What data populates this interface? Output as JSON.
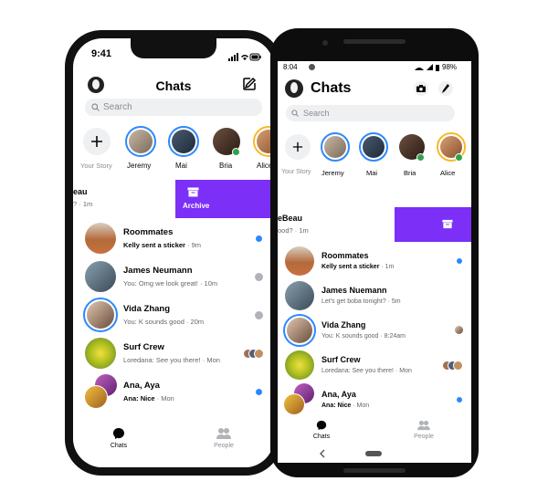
{
  "iphone": {
    "time": "9:41",
    "title": "Chats",
    "search_placeholder": "Search",
    "stories": [
      {
        "name": "Your Story"
      },
      {
        "name": "Jeremy"
      },
      {
        "name": "Mai"
      },
      {
        "name": "Bria"
      },
      {
        "name": "Alice"
      }
    ],
    "swiped_row": {
      "name_fragment": "eau",
      "sub_fragment": "? · 1m",
      "action_label": "Archive"
    },
    "chats": [
      {
        "name": "Roommates",
        "sender": "Kelly sent a sticker",
        "time": "9m",
        "status": "unread"
      },
      {
        "name": "James Neumann",
        "preview": "You: Omg we look great!",
        "time": "10m",
        "status": "sent"
      },
      {
        "name": "Vida Zhang",
        "preview": "You: K sounds good",
        "time": "20m",
        "status": "sent"
      },
      {
        "name": "Surf Crew",
        "preview": "Loredana: See you there!",
        "time": "Mon",
        "status": "seen"
      },
      {
        "name": "Ana, Aya",
        "sender": "Ana: Nice",
        "time": "Mon",
        "status": "unread"
      }
    ],
    "tabs": [
      {
        "label": "Chats"
      },
      {
        "label": "People"
      }
    ]
  },
  "android": {
    "time": "8:04",
    "battery": "98%",
    "title": "Chats",
    "search_placeholder": "Search",
    "stories": [
      {
        "name": "Your Story"
      },
      {
        "name": "Jeremy"
      },
      {
        "name": "Mai"
      },
      {
        "name": "Bria"
      },
      {
        "name": "Alice"
      }
    ],
    "swiped_row": {
      "name_fragment": "eBeau",
      "sub_fragment": "ood? · 1m"
    },
    "chats": [
      {
        "name": "Roommates",
        "sender": "Kelly sent a sticker",
        "time": "1m",
        "status": "unread"
      },
      {
        "name": "James Nuemann",
        "preview": "Let's get boba tonight?",
        "time": "5m",
        "status": "none"
      },
      {
        "name": "Vida Zhang",
        "preview": "You: K sounds good",
        "time": "8:24am",
        "status": "seen"
      },
      {
        "name": "Surf Crew",
        "preview": "Loredana: See you there!",
        "time": "Mon",
        "status": "seen"
      },
      {
        "name": "Ana, Aya",
        "sender": "Ana: Nice",
        "time": "Mon",
        "status": "unread"
      }
    ],
    "tabs": [
      {
        "label": "Chats"
      },
      {
        "label": "People"
      }
    ]
  },
  "colors": {
    "accent": "#2d88ff",
    "archive": "#7b2ff7",
    "online": "#31a24c"
  }
}
